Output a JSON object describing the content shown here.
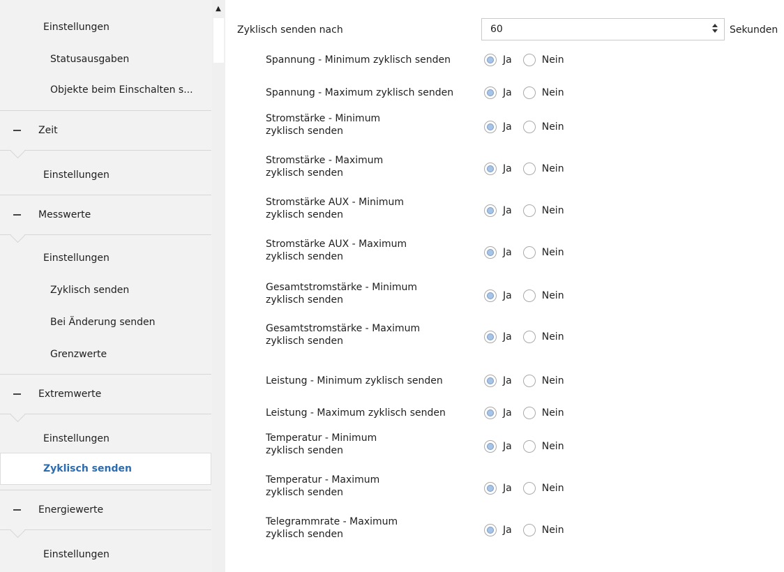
{
  "nav": {
    "items": [
      {
        "label": "Einstellungen"
      },
      {
        "label": "Statusausgaben"
      },
      {
        "label": "Objekte beim Einschalten s..."
      }
    ],
    "sections": [
      {
        "title": "Zeit",
        "items": [
          "Einstellungen"
        ]
      },
      {
        "title": "Messwerte",
        "items": [
          "Einstellungen",
          "Zyklisch senden",
          "Bei Änderung senden",
          "Grenzwerte"
        ]
      },
      {
        "title": "Extremwerte",
        "items": [
          "Einstellungen",
          "Zyklisch senden"
        ],
        "selected": "Zyklisch senden"
      },
      {
        "title": "Energiewerte",
        "items": [
          "Einstellungen"
        ]
      }
    ]
  },
  "main": {
    "cycle": {
      "label": "Zyklisch senden nach",
      "value": "60",
      "unit": "Sekunden"
    },
    "options": {
      "yes": "Ja",
      "no": "Nein"
    },
    "params": [
      {
        "label": "Spannung - Minimum zyklisch senden",
        "value": "Ja"
      },
      {
        "label": "Spannung - Maximum zyklisch senden",
        "value": "Ja"
      },
      {
        "label": "Stromstärke - Minimum\nzyklisch senden",
        "value": "Ja"
      },
      {
        "label": "Stromstärke - Maximum\nzyklisch senden",
        "value": "Ja"
      },
      {
        "label": "Stromstärke AUX - Minimum\nzyklisch senden",
        "value": "Ja"
      },
      {
        "label": "Stromstärke AUX - Maximum\nzyklisch senden",
        "value": "Ja"
      },
      {
        "label": "Gesamtstromstärke - Minimum\nzyklisch senden",
        "value": "Ja"
      },
      {
        "label": "Gesamtstromstärke - Maximum\nzyklisch senden",
        "value": "Ja"
      },
      {
        "label": "Leistung - Minimum zyklisch senden",
        "value": "Ja"
      },
      {
        "label": "Leistung - Maximum zyklisch senden",
        "value": "Ja"
      },
      {
        "label": "Temperatur - Minimum\nzyklisch senden",
        "value": "Ja"
      },
      {
        "label": "Temperatur - Maximum\nzyklisch senden",
        "value": "Ja"
      },
      {
        "label": "Telegrammrate - Maximum\nzyklisch senden",
        "value": "Ja"
      }
    ]
  },
  "colors": {
    "accent": "#2b6cb0",
    "nav_bg": "#f2f2f2",
    "radio_fill": "#a7c4e6"
  }
}
